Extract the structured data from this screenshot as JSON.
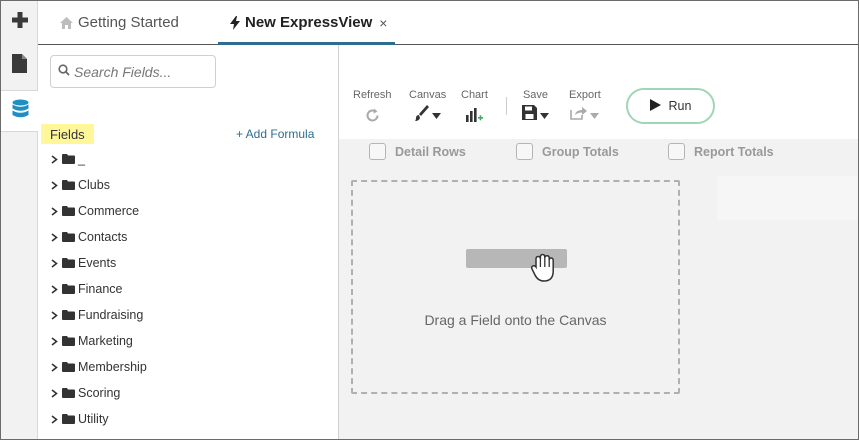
{
  "rail": {
    "items": [
      {
        "icon": "plus-icon"
      },
      {
        "icon": "document-icon"
      },
      {
        "icon": "database-icon",
        "active": true
      }
    ]
  },
  "tabs": [
    {
      "label": "Getting Started",
      "icon": "home-icon"
    },
    {
      "label": "New ExpressView",
      "icon": "lightning-icon",
      "close": "×",
      "active": true
    }
  ],
  "fields_panel": {
    "search_placeholder": "Search Fields...",
    "heading": "Fields",
    "add_formula": "+ Add Formula",
    "items": [
      "_",
      "Clubs",
      "Commerce",
      "Contacts",
      "Events",
      "Finance",
      "Fundraising",
      "Marketing",
      "Membership",
      "Scoring",
      "Utility"
    ]
  },
  "toolbar": {
    "refresh": "Refresh",
    "canvas": "Canvas",
    "chart": "Chart",
    "save": "Save",
    "export": "Export",
    "run": "Run"
  },
  "options": {
    "detail_rows": "Detail Rows",
    "group_totals": "Group Totals",
    "report_totals": "Report Totals"
  },
  "canvas": {
    "drop_text": "Drag a Field onto the Canvas"
  },
  "colors": {
    "accent": "#2d6e8e",
    "highlight": "#fff799",
    "run_border": "#9fd6b6",
    "chart_plus": "#3fae5a"
  }
}
